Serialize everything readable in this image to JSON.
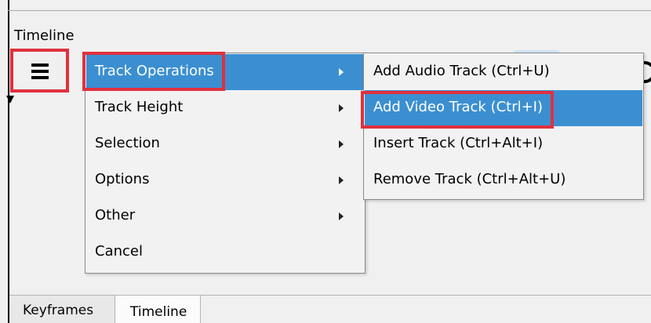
{
  "panel": {
    "title": "Timeline"
  },
  "menu": {
    "items": [
      {
        "label": "Track Operations",
        "has_submenu": true,
        "highlighted": true
      },
      {
        "label": "Track Height",
        "has_submenu": true
      },
      {
        "label": "Selection",
        "has_submenu": true
      },
      {
        "label": "Options",
        "has_submenu": true
      },
      {
        "label": "Other",
        "has_submenu": true
      },
      {
        "label": "Cancel",
        "has_submenu": false
      }
    ]
  },
  "submenu": {
    "items": [
      {
        "label": "Add Audio Track (Ctrl+U)"
      },
      {
        "label": "Add Video Track (Ctrl+I)",
        "highlighted": true
      },
      {
        "label": "Insert Track (Ctrl+Alt+I)"
      },
      {
        "label": "Remove Track (Ctrl+Alt+U)"
      }
    ]
  },
  "tabs": [
    {
      "label": "Keyframes",
      "active": false
    },
    {
      "label": "Timeline",
      "active": true
    }
  ],
  "colors": {
    "highlight": "#3b8fd1",
    "annotation": "#e0313e"
  },
  "icons": {
    "menu_button": "hamburger-menu-icon",
    "submenu_arrow": "chevron-right-icon"
  }
}
